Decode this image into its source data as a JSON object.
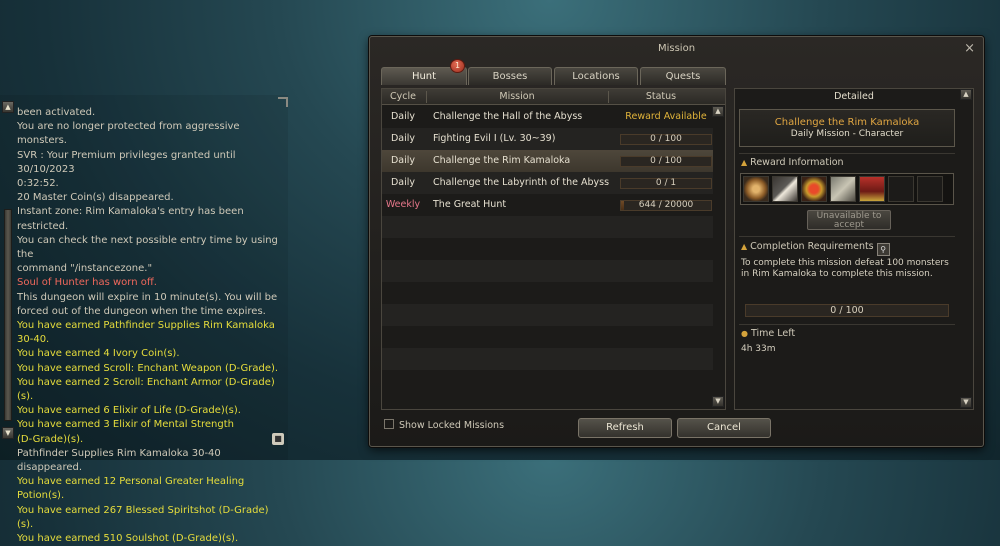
{
  "chat": {
    "lines": [
      {
        "text": "been activated.",
        "kind": "sys"
      },
      {
        "text": "You are no longer protected from aggressive monsters.",
        "kind": "sys"
      },
      {
        "text": "SVR : Your Premium privileges granted until 30/10/2023",
        "kind": "sys"
      },
      {
        "text": "0:32:52.",
        "kind": "sys"
      },
      {
        "text": "20 Master Coin(s) disappeared.",
        "kind": "sys"
      },
      {
        "text": "Instant zone: Rim Kamaloka's entry has been restricted.",
        "kind": "sys"
      },
      {
        "text": "You can check the next possible entry time by using the",
        "kind": "sys"
      },
      {
        "text": "command \"/instancezone.\"",
        "kind": "sys"
      },
      {
        "text": "Soul of Hunter has worn off.",
        "kind": "warn"
      },
      {
        "text": "This dungeon will expire in 10 minute(s). You will be",
        "kind": "sys"
      },
      {
        "text": "forced out of the dungeon when the time expires.",
        "kind": "sys"
      },
      {
        "text": "You have earned Pathfinder Supplies Rim Kamaloka",
        "kind": "earn"
      },
      {
        "text": "30-40.",
        "kind": "earn"
      },
      {
        "text": "You have earned 4 Ivory Coin(s).",
        "kind": "earn"
      },
      {
        "text": "You have earned Scroll: Enchant Weapon (D-Grade).",
        "kind": "earn"
      },
      {
        "text": "You have earned 2 Scroll: Enchant Armor (D-Grade)(s).",
        "kind": "earn"
      },
      {
        "text": "You have earned 6 Elixir of Life (D-Grade)(s).",
        "kind": "earn"
      },
      {
        "text": "You have earned 3 Elixir of Mental Strength",
        "kind": "earn"
      },
      {
        "text": "(D-Grade)(s).",
        "kind": "earn"
      },
      {
        "text": "Pathfinder Supplies Rim Kamaloka 30-40 disappeared.",
        "kind": "sys"
      },
      {
        "text": "You have earned 12 Personal Greater Healing Potion(s).",
        "kind": "earn"
      },
      {
        "text": "You have earned 267 Blessed Spiritshot (D-Grade)(s).",
        "kind": "earn"
      },
      {
        "text": "You have earned 510 Soulshot (D-Grade)(s).",
        "kind": "earn"
      }
    ]
  },
  "window": {
    "title": "Mission",
    "close_icon": "×",
    "tabs": [
      {
        "label": "Hunt",
        "badge": "1"
      },
      {
        "label": "Bosses"
      },
      {
        "label": "Locations"
      },
      {
        "label": "Quests"
      }
    ],
    "columns": {
      "cycle": "Cycle",
      "mission": "Mission",
      "status": "Status"
    },
    "missions": [
      {
        "cycle": "Daily",
        "name": "Challenge the Hall of the Abyss",
        "status_text": "Reward Available",
        "progress": null
      },
      {
        "cycle": "Daily",
        "name": "Fighting Evil I (Lv. 30~39)",
        "status_text": "0 / 100",
        "progress": 0
      },
      {
        "cycle": "Daily",
        "name": "Challenge the Rim Kamaloka",
        "status_text": "0 / 100",
        "progress": 0
      },
      {
        "cycle": "Daily",
        "name": "Challenge the Labyrinth of the Abyss",
        "status_text": "0 / 1",
        "progress": 0
      },
      {
        "cycle": "Weekly",
        "name": "The Great Hunt",
        "status_text": "644 / 20000",
        "progress": 0.0322
      }
    ],
    "show_locked_label": "Show Locked Missions",
    "refresh_label": "Refresh",
    "cancel_label": "Cancel"
  },
  "detail": {
    "header": "Detailed",
    "mission_title": "Challenge the Rim Kamaloka",
    "mission_subtitle": "Daily Mission  -  Character",
    "reward_label": "Reward Information",
    "reward_items": [
      "coin",
      "scroll",
      "elixir",
      "supply-box",
      "chest"
    ],
    "unavailable_label": "Unavailable to accept",
    "completion_label": "Completion Requirements",
    "completion_desc": "To complete this mission defeat 100 monsters in Rim Kamaloka to complete this mission.",
    "progress_text": "0 / 100",
    "progress": 0,
    "time_left_label": "Time Left",
    "time_left_value": "4h 33m"
  }
}
